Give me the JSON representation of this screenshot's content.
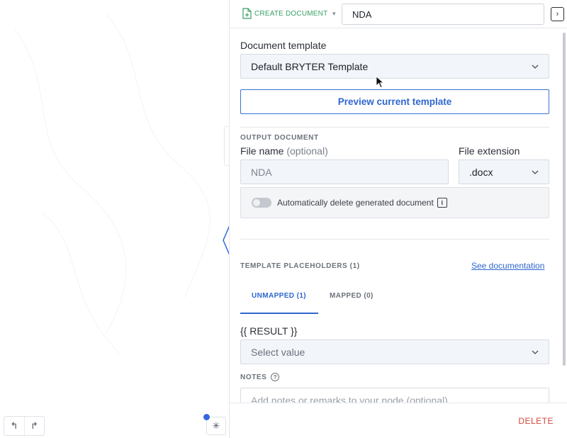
{
  "header": {
    "create_label": "CREATE DOCUMENT",
    "title_value": "NDA"
  },
  "template": {
    "label": "Document template",
    "selected": "Default BRYTER Template",
    "preview_label": "Preview current template"
  },
  "output": {
    "section_title": "OUTPUT DOCUMENT",
    "file_name_label": "File name",
    "file_name_optional": "(optional)",
    "file_name_placeholder": "NDA",
    "extension_label": "File extension",
    "extension_value": ".docx",
    "auto_delete_label": "Automatically delete generated document",
    "auto_delete_on": false
  },
  "placeholders": {
    "section_title": "TEMPLATE PLACEHOLDERS (1)",
    "doc_link": "See documentation",
    "tabs": [
      {
        "label": "UNMAPPED (1)",
        "active": true
      },
      {
        "label": "MAPPED (0)",
        "active": false
      }
    ],
    "item_label": "{{ RESULT }}",
    "select_placeholder": "Select value"
  },
  "notes": {
    "title": "NOTES",
    "placeholder": "Add notes or remarks to your node (optional)"
  },
  "footer": {
    "delete_label": "DELETE"
  },
  "colors": {
    "accent": "#2f67cf",
    "create": "#3aa066",
    "danger": "#d5443b"
  }
}
